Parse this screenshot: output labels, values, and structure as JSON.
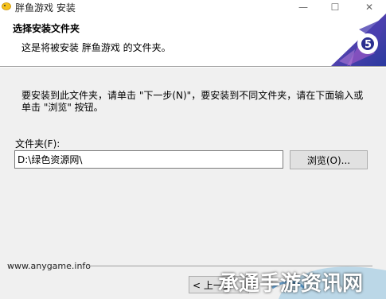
{
  "window": {
    "title": "胖鱼游戏 安装",
    "icon": "app-fish-icon",
    "controls": {
      "minimize": "—",
      "maximize": "☐",
      "close": "✕"
    }
  },
  "header": {
    "title": "选择安装文件夹",
    "subtitle": "这是将被安装 胖鱼游戏 的文件夹。",
    "logo": "gear-logo-icon"
  },
  "body": {
    "instruction": "要安装到此文件夹，请单击 \"下一步(N)\"，要安装到不同文件夹，请在下面输入或\n单击 \"浏览\" 按钮。",
    "folder_label": "文件夹(F):",
    "folder_value": "D:\\绿色资源网\\",
    "browse_label": "浏览(O)..."
  },
  "footer": {
    "brand": "www.anygame.info",
    "back_label": "< 上一步"
  },
  "watermark": {
    "text": "承通手游资讯网"
  },
  "colors": {
    "dialog_bg": "#f0f0f0",
    "button_bg": "#e1e1e1",
    "logo_blue": "#3f3caa",
    "logo_purple": "#8a4bb0"
  }
}
